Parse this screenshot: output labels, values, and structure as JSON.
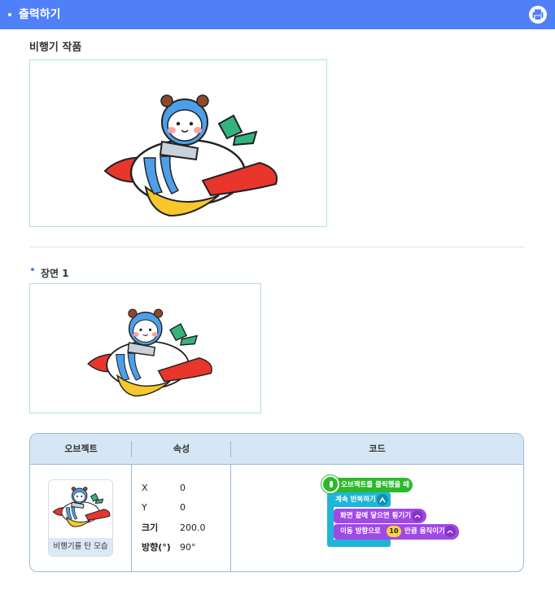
{
  "header": {
    "title": "출력하기",
    "print_icon": "print-icon",
    "accent_color": "#4f80f7"
  },
  "artwork": {
    "title": "비행기 작품"
  },
  "scene": {
    "title": "장면 1"
  },
  "table": {
    "columns": [
      "오브젝트",
      "속성",
      "코드"
    ],
    "object": {
      "name": "비행기를 탄 모습"
    },
    "properties": [
      {
        "key": "X",
        "value": "0"
      },
      {
        "key": "Y",
        "value": "0"
      },
      {
        "key": "크기",
        "value": "200.0"
      },
      {
        "key": "방향(°)",
        "value": "90°"
      }
    ],
    "code": {
      "event": "오브젝트를 클릭했을 때",
      "loop": "계속 반복하기",
      "bounce": "화면 끝에 닿으면 튕기기",
      "move_prefix": "이동 방향으로",
      "move_value": "10",
      "move_suffix": "만큼 움직이기"
    }
  }
}
